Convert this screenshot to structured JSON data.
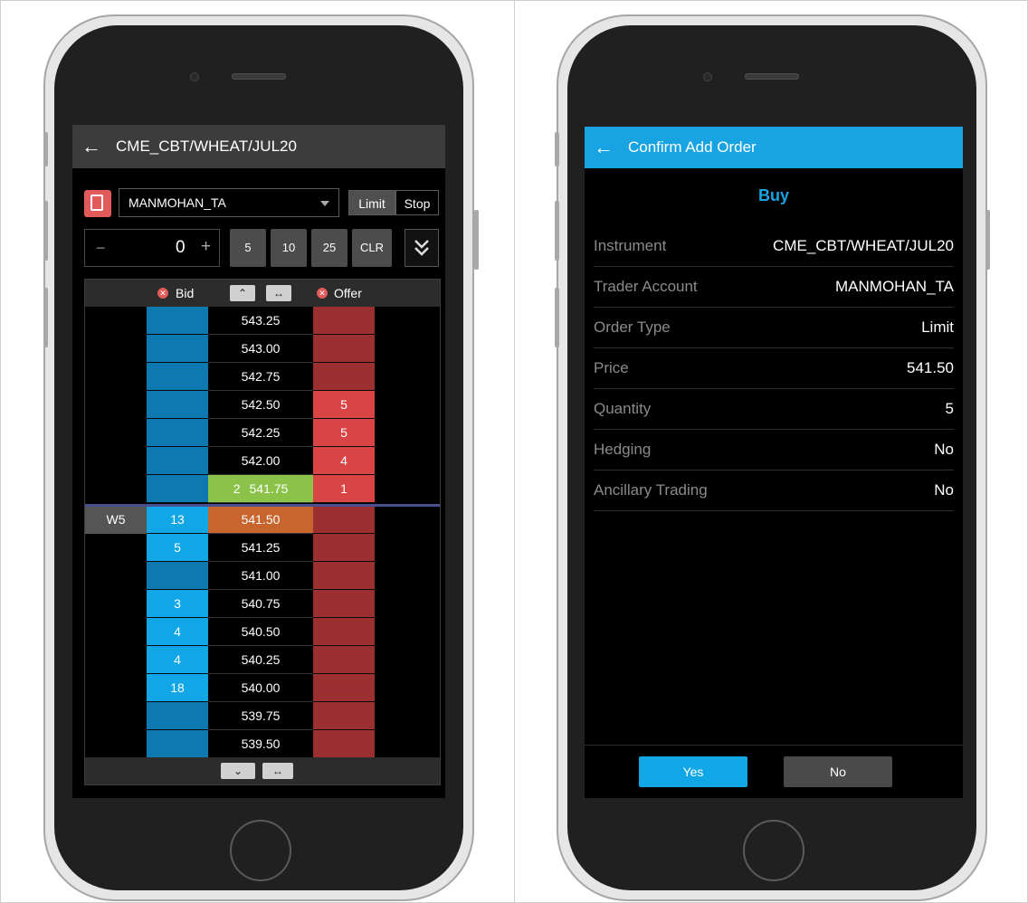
{
  "left": {
    "header_title": "CME_CBT/WHEAT/JUL20",
    "account": "MANMOHAN_TA",
    "order_types": [
      "Limit",
      "Stop"
    ],
    "quantity": "0",
    "minus": "−",
    "plus": "+",
    "qty_presets": [
      "5",
      "10",
      "25",
      "CLR"
    ],
    "bid_label": "Bid",
    "offer_label": "Offer",
    "working_label": "W5",
    "ladder": [
      {
        "price": "543.25",
        "bid": "",
        "offer": ""
      },
      {
        "price": "543.00",
        "bid": "",
        "offer": ""
      },
      {
        "price": "542.75",
        "bid": "",
        "offer": ""
      },
      {
        "price": "542.50",
        "bid": "",
        "offer": "5"
      },
      {
        "price": "542.25",
        "bid": "",
        "offer": "5"
      },
      {
        "price": "542.00",
        "bid": "",
        "offer": "4"
      },
      {
        "price": "541.75",
        "ltq": "2",
        "bid": "",
        "offer": "1"
      },
      {
        "price": "541.50",
        "bid": "13",
        "offer": ""
      },
      {
        "price": "541.25",
        "bid": "5",
        "offer": ""
      },
      {
        "price": "541.00",
        "bid": "",
        "offer": ""
      },
      {
        "price": "540.75",
        "bid": "3",
        "offer": ""
      },
      {
        "price": "540.50",
        "bid": "4",
        "offer": ""
      },
      {
        "price": "540.25",
        "bid": "4",
        "offer": ""
      },
      {
        "price": "540.00",
        "bid": "18",
        "offer": ""
      },
      {
        "price": "539.75",
        "bid": "",
        "offer": ""
      },
      {
        "price": "539.50",
        "bid": "",
        "offer": ""
      }
    ]
  },
  "right": {
    "header_title": "Confirm Add Order",
    "side": "Buy",
    "fields": [
      {
        "key": "Instrument",
        "value": "CME_CBT/WHEAT/JUL20"
      },
      {
        "key": "Trader Account",
        "value": "MANMOHAN_TA"
      },
      {
        "key": "Order Type",
        "value": "Limit"
      },
      {
        "key": "Price",
        "value": "541.50"
      },
      {
        "key": "Quantity",
        "value": "5"
      },
      {
        "key": "Hedging",
        "value": "No"
      },
      {
        "key": "Ancillary Trading",
        "value": "No"
      }
    ],
    "yes_label": "Yes",
    "no_label": "No"
  },
  "colors": {
    "accent": "#18a3e2",
    "bid_dark": "#0e78b0",
    "bid_light": "#11a6e6",
    "offer_dark": "#9b2e2e",
    "offer_light": "#d94545",
    "last_trade": "#8bc34a",
    "working": "#c8642d"
  }
}
